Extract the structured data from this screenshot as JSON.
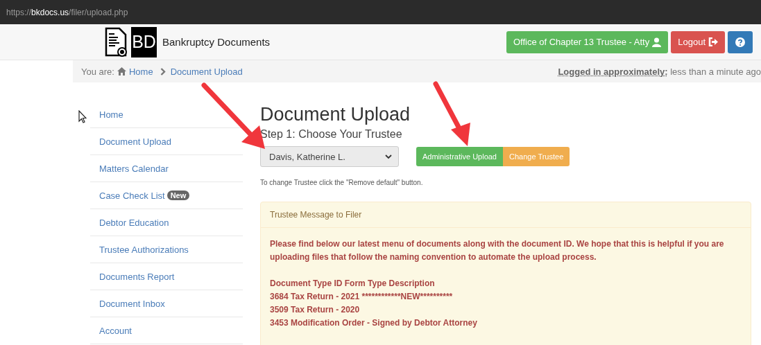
{
  "address_bar": {
    "scheme": "https://",
    "host": "bkdocs.us",
    "path": "/filer/upload.php"
  },
  "header": {
    "brand_mark": "BD",
    "brand": "Bankruptcy Documents",
    "buttons": [
      {
        "kind": "user",
        "label": "Office of Chapter 13 Trustee - Atty"
      },
      {
        "kind": "logout",
        "label": "Logout"
      },
      {
        "kind": "help"
      }
    ]
  },
  "breadcrumb": {
    "prefix": "You are:",
    "items": [
      {
        "label": "Home"
      },
      {
        "label": "Document Upload"
      }
    ],
    "login_label": "Logged in approximately:",
    "login_value": "less than a minute ago"
  },
  "sidebar": {
    "items": [
      {
        "label": "Home"
      },
      {
        "label": "Document Upload"
      },
      {
        "label": "Matters Calendar"
      },
      {
        "label": "Case Check List",
        "badge": "New"
      },
      {
        "label": "Debtor Education"
      },
      {
        "label": "Trustee Authorizations"
      },
      {
        "label": "Documents Report"
      },
      {
        "label": "Document Inbox"
      },
      {
        "label": "Account"
      }
    ]
  },
  "main": {
    "title": "Document Upload",
    "step": "Step 1: Choose Your Trustee",
    "trustee_select": {
      "value": "Davis, Katherine L."
    },
    "buttons": [
      {
        "kind": "success",
        "label": "Administrative Upload"
      },
      {
        "kind": "warning",
        "label": "Change Trustee"
      }
    ],
    "hint": "To change Trustee click the \"Remove default\" button.",
    "message": {
      "title": "Trustee Message to Filer",
      "paragraph": "Please find below our latest menu of documents along with the document ID. We hope that this is helpful if you are uploading files that follow the naming convention to automate the upload process.",
      "lines": [
        "Document Type ID Form Type Description",
        "3684 Tax Return - 2021 ************NEW**********",
        "3509 Tax Return - 2020",
        "3453 Modification Order - Signed by Debtor Attorney"
      ]
    }
  }
}
